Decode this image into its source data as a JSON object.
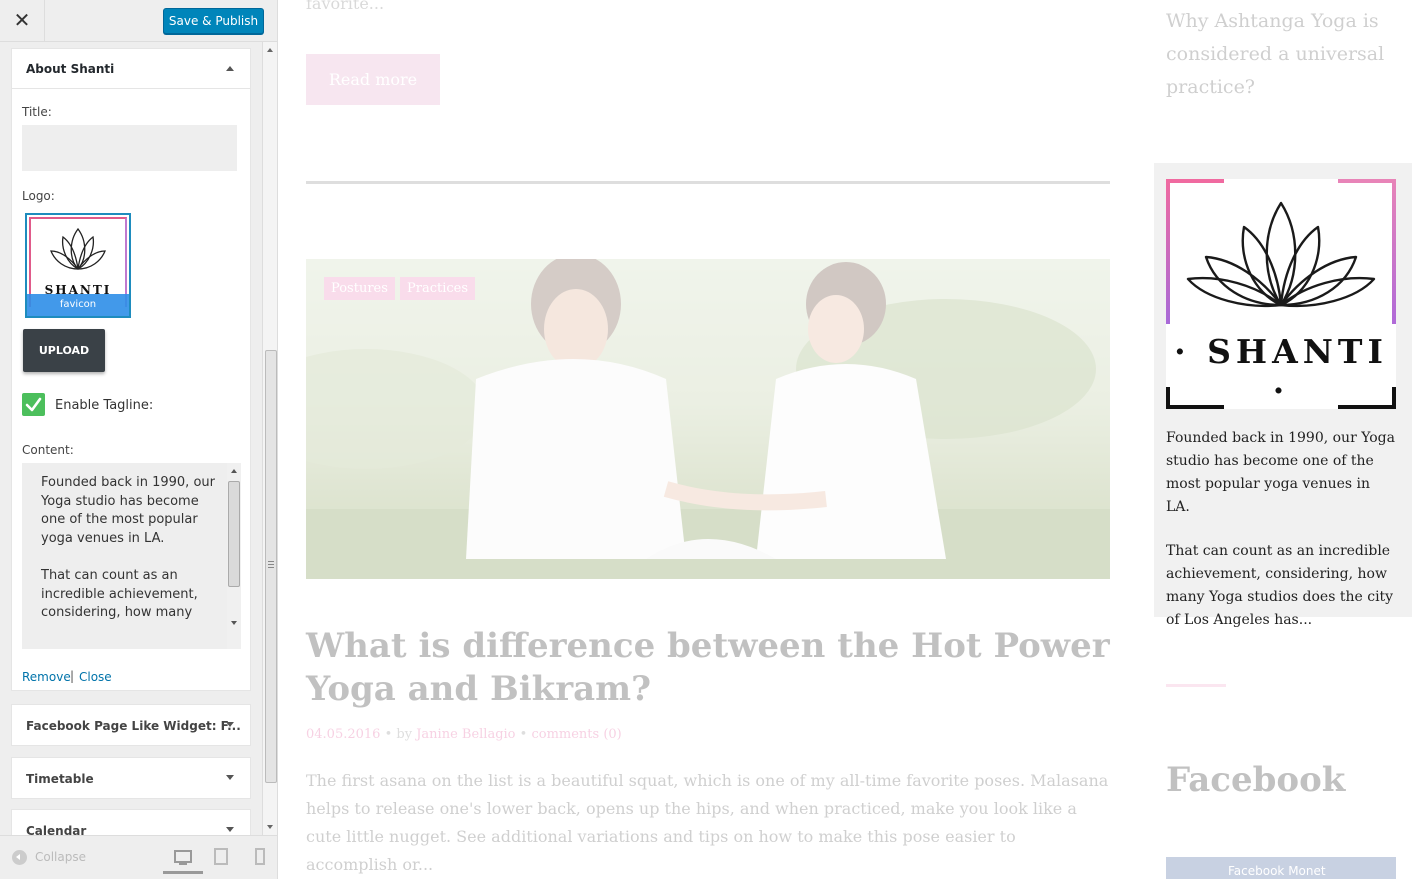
{
  "header": {
    "close_glyph": "✕",
    "publish_label": "Save & Publish"
  },
  "about_widget": {
    "title": "About Shanti",
    "title_label": "Title:",
    "title_value": "",
    "logo_label": "Logo:",
    "logo_brand": "SHANTI",
    "logo_caption": "favicon",
    "upload_label": "UPLOAD",
    "tagline_label": "Enable Tagline:",
    "tagline_checked": true,
    "content_label": "Content:",
    "content_value": "Founded back in 1990, our Yoga studio has become one of the most popular yoga venues in LA.\n\nThat can count as an incredible achievement, considering, how many",
    "remove_label": "Remove",
    "separator": "|",
    "close_label": "Close"
  },
  "collapsed_widgets": [
    {
      "label": "Facebook Page Like Widget: F..."
    },
    {
      "label": "Timetable"
    },
    {
      "label": "Calendar"
    }
  ],
  "footer": {
    "collapse_label": "Collapse"
  },
  "preview": {
    "prev_excerpt_tail": "favorite...",
    "read_more_label": "Read more",
    "tags": [
      "Postures",
      "Practices"
    ],
    "post_title": "What is difference between the Hot Power Yoga and Bikram?",
    "post_date": "04.05.2016",
    "post_by": "by",
    "post_author": "Janine Bellagio",
    "post_comments": "comments (0)",
    "post_excerpt": "The first asana on the list is a beautiful squat, which is one of my all-time favorite poses. Malasana helps to release one's lower back, opens up the hips, and when practiced, make you look like a cute little nugget. See additional variations and tips on how to make this pose easier to accomplish or...",
    "sidebar_question": "Why Ashtanga Yoga is considered a universal practice?",
    "about_brand": "· SHANTI ·",
    "about_p1": "Founded back in 1990, our Yoga studio has become one of the most popular yoga venues in LA.",
    "about_p2": "That can count as an incredible achievement, considering, how many Yoga studios does the city of Los Angeles has...",
    "facebook_title": "Facebook",
    "facebook_box_text": "Facebook Monet"
  },
  "colors": {
    "publish_blue": "#0085ba",
    "check_green": "#4cbf5c",
    "accent_pink": "#e05a9a",
    "facebook_blue": "#3b5998"
  },
  "icons": [
    "close-icon",
    "chevron-up-icon",
    "chevron-down-icon",
    "checkmark-icon",
    "lotus-icon",
    "collapse-icon",
    "desktop-icon",
    "tablet-icon",
    "mobile-icon"
  ]
}
